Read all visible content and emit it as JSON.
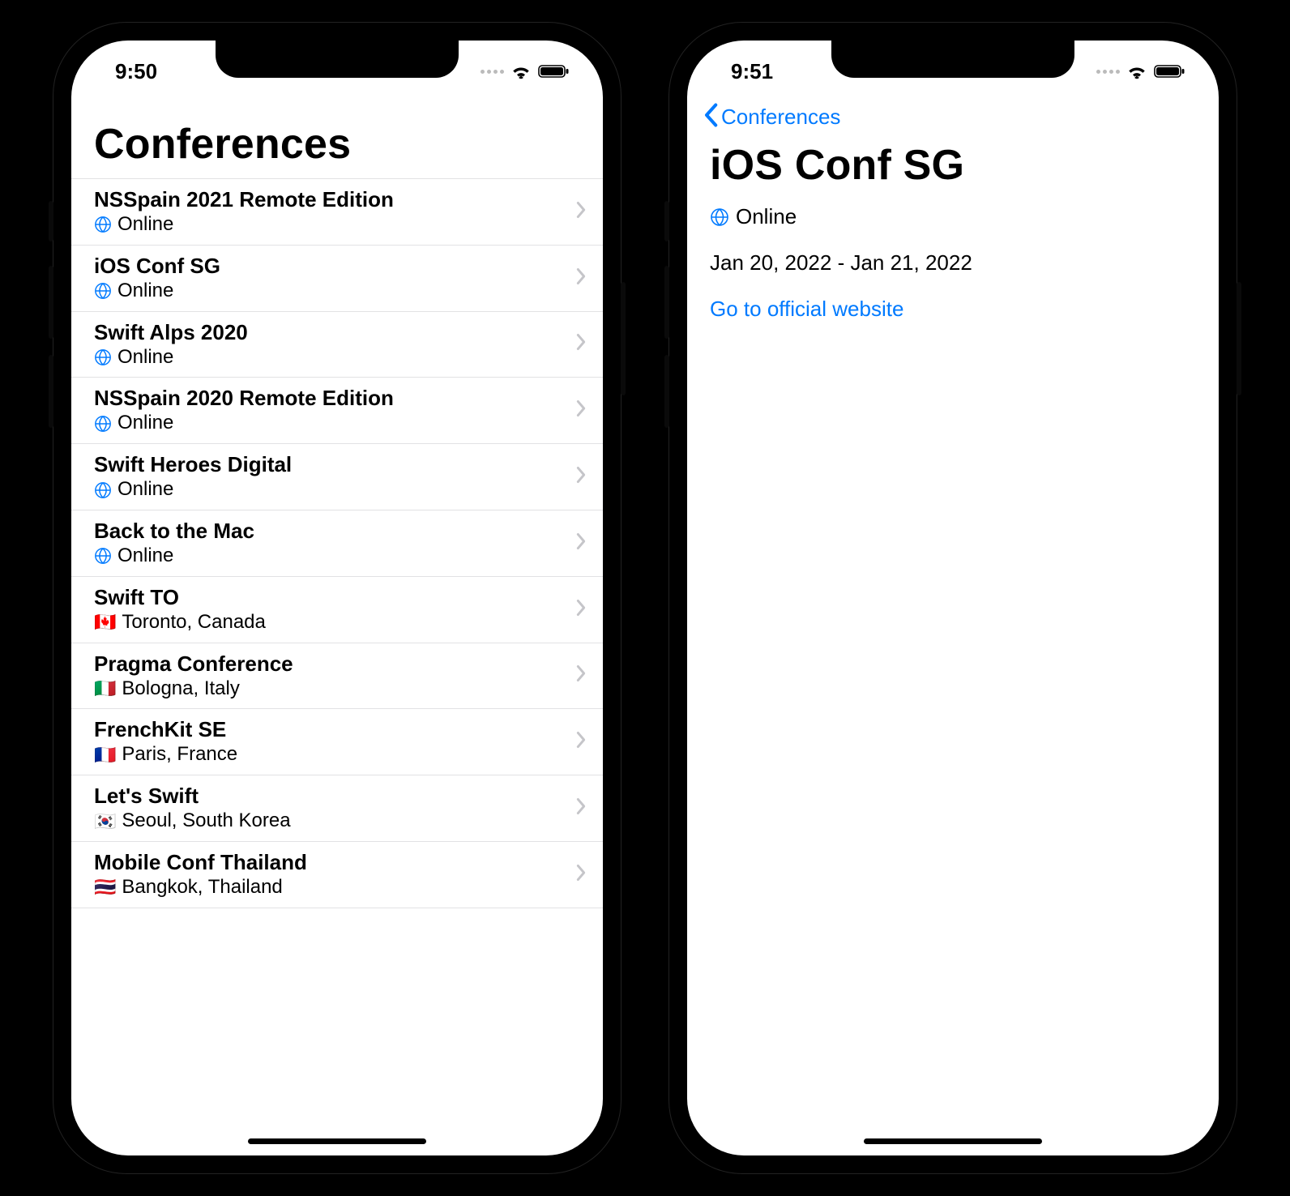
{
  "left": {
    "status_time": "9:50",
    "title": "Conferences",
    "rows": [
      {
        "title": "NSSpain 2021 Remote Edition",
        "icon": "globe",
        "location": "Online"
      },
      {
        "title": "iOS Conf SG",
        "icon": "globe",
        "location": "Online"
      },
      {
        "title": "Swift Alps 2020",
        "icon": "globe",
        "location": "Online"
      },
      {
        "title": "NSSpain 2020 Remote Edition",
        "icon": "globe",
        "location": "Online"
      },
      {
        "title": "Swift Heroes Digital",
        "icon": "globe",
        "location": "Online"
      },
      {
        "title": "Back to the Mac",
        "icon": "globe",
        "location": "Online"
      },
      {
        "title": "Swift TO",
        "icon": "flag",
        "flag": "🇨🇦",
        "location": "Toronto, Canada"
      },
      {
        "title": "Pragma Conference",
        "icon": "flag",
        "flag": "🇮🇹",
        "location": "Bologna, Italy"
      },
      {
        "title": "FrenchKit SE",
        "icon": "flag",
        "flag": "🇫🇷",
        "location": "Paris, France"
      },
      {
        "title": "Let's Swift",
        "icon": "flag",
        "flag": "🇰🇷",
        "location": "Seoul, South Korea"
      },
      {
        "title": "Mobile Conf Thailand",
        "icon": "flag",
        "flag": "🇹🇭",
        "location": "Bangkok, Thailand"
      }
    ]
  },
  "right": {
    "status_time": "9:51",
    "back_label": "Conferences",
    "title": "iOS Conf SG",
    "location": "Online",
    "dates": "Jan 20, 2022 - Jan 21, 2022",
    "link_label": "Go to official website"
  },
  "colors": {
    "accent": "#007aff"
  }
}
